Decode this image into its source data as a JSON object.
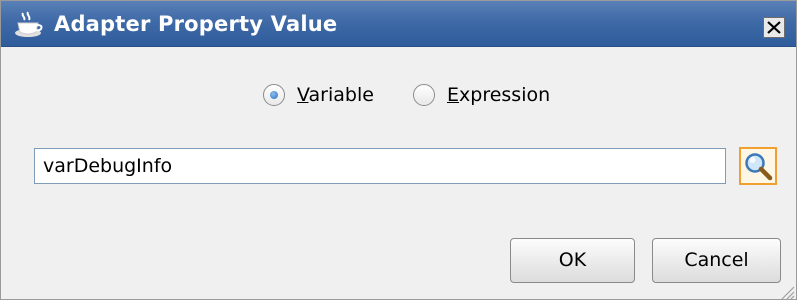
{
  "window": {
    "title": "Adapter Property Value",
    "icon": "coffee-cup-icon",
    "close_icon": "close-icon"
  },
  "mode": {
    "options": [
      {
        "label_prefix": "",
        "mnemonic": "V",
        "label_rest": "ariable",
        "selected": true
      },
      {
        "label_prefix": "",
        "mnemonic": "E",
        "label_rest": "xpression",
        "selected": false
      }
    ]
  },
  "value_field": {
    "value": "varDebugInfo"
  },
  "search_button": {
    "icon": "magnifier-icon"
  },
  "buttons": {
    "ok_label": "OK",
    "cancel_label": "Cancel"
  },
  "colors": {
    "titlebar": "#3f6aa7",
    "search_highlight": "#f0a030"
  }
}
